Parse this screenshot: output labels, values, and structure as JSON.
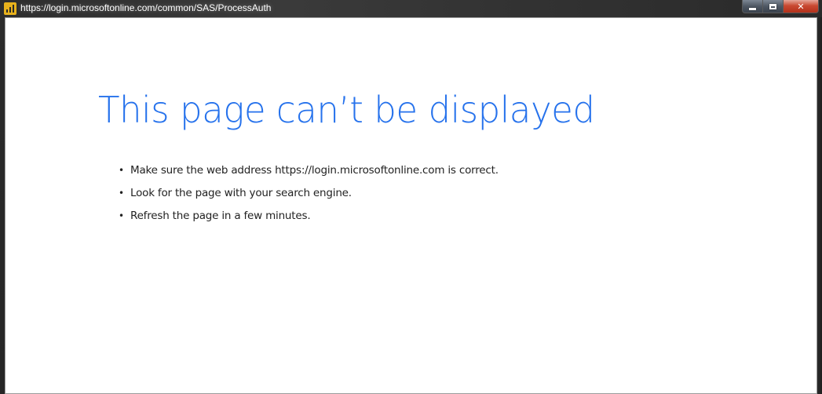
{
  "window": {
    "url": "https://login.microsoftonline.com/common/SAS/ProcessAuth",
    "app_icon": "power-bi-icon",
    "controls": {
      "minimize_icon": "minimize-icon",
      "maximize_icon": "maximize-icon",
      "close_icon": "close-icon",
      "close_glyph": "✕"
    }
  },
  "error_page": {
    "heading": "This page can’t be displayed",
    "bullet_glyph": "•",
    "suggestions": [
      "Make sure the web address https://login.microsoftonline.com is correct.",
      "Look for the page with your search engine.",
      "Refresh the page in a few minutes."
    ]
  },
  "colors": {
    "heading": "#2672ec",
    "body_text": "#222222",
    "page_background": "#ffffff",
    "close_button": "#c94a32"
  }
}
